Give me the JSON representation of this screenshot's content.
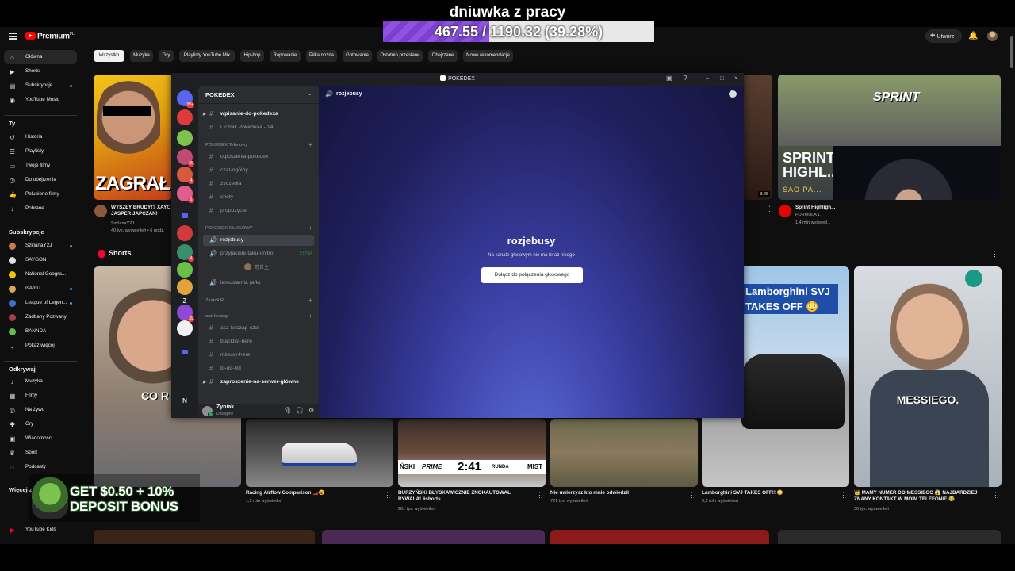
{
  "overlay": {
    "title": "dniuwka z pracy",
    "progress_text": "467.55 / 1190.32 (39.28%)",
    "progress_fraction": 0.3928,
    "progress_color": "#7c3fd1"
  },
  "youtube": {
    "brand": "Premium",
    "brand_sup": "PL",
    "create_label": "Utwórz",
    "nav": [
      {
        "label": "Główna",
        "icon": "home-icon",
        "active": true
      },
      {
        "label": "Shorts",
        "icon": "shorts-icon"
      },
      {
        "label": "Subskrypcje",
        "icon": "subscriptions-icon",
        "dot": true
      },
      {
        "label": "YouTube Music",
        "icon": "music-icon"
      }
    ],
    "you_heading": "Ty",
    "you_items": [
      {
        "label": "Historia",
        "icon": "history-icon"
      },
      {
        "label": "Playlisty",
        "icon": "playlist-icon"
      },
      {
        "label": "Twoje filmy",
        "icon": "video-icon"
      },
      {
        "label": "Do obejrzenia",
        "icon": "clock-icon"
      },
      {
        "label": "Polubione filmy",
        "icon": "like-icon"
      },
      {
        "label": "Pobrane",
        "icon": "download-icon"
      }
    ],
    "subs_heading": "Subskrypcje",
    "subs": [
      {
        "label": "SzklanaY2J",
        "color": "#c77b4a",
        "dot": true
      },
      {
        "label": "SAYGON",
        "color": "#e0e0e0"
      },
      {
        "label": "National Geogra...",
        "color": "#f5c400"
      },
      {
        "label": "IsAmU",
        "color": "#d9a85c",
        "dot": true
      },
      {
        "label": "League of Legen...",
        "color": "#3b6fd1",
        "dot": true
      },
      {
        "label": "Zadbany Pozwany",
        "color": "#a04040"
      },
      {
        "label": "BANNDA",
        "color": "#5cc24c"
      },
      {
        "label": "Pokaż więcej",
        "color": "",
        "icon": "chevron-down-icon"
      }
    ],
    "explore_heading": "Odkrywaj",
    "explore": [
      {
        "label": "Muzyka",
        "icon": "music-note-icon"
      },
      {
        "label": "Filmy",
        "icon": "film-icon"
      },
      {
        "label": "Na żywo",
        "icon": "live-icon"
      },
      {
        "label": "Gry",
        "icon": "gamepad-icon"
      },
      {
        "label": "Wiadomości",
        "icon": "news-icon"
      },
      {
        "label": "Sport",
        "icon": "trophy-icon"
      },
      {
        "label": "Podcasty",
        "icon": "podcast-icon"
      }
    ],
    "more_heading": "Więcej z",
    "more_items": [
      {
        "label": "YouTube Kids",
        "icon": "yt-kids-icon"
      }
    ],
    "chips": [
      "Wszystko",
      "Muzyka",
      "Gry",
      "Playlisty YouTube Mix",
      "Hip-hop",
      "Rapowanie",
      "Piłka nożna",
      "Gotowanie",
      "Ostatnio przesłane",
      "Obejrzane",
      "Nowe rekomendacje"
    ],
    "videos": [
      {
        "title": "WYSZŁY BRUDY!? XAYO JASPER JAPCZAN! SZK...",
        "channel": "SzklanaY2J",
        "meta": "40 tys. wyświetleń • 6 godz.",
        "thumb_text": "ZAGRAŁ"
      },
      {
        "title": "",
        "duration": "3:26"
      },
      {
        "title": "Sprint Highligh...",
        "channel": "FORMULA 1",
        "meta": "1,4 mln wyświetl...",
        "thumb_text": "SPRINT",
        "thumb_text2": "SPRINT HIGHL...",
        "thumb_text3": "SAO PA..."
      }
    ],
    "shorts_heading": "Shorts",
    "shorts": [
      {
        "title": "",
        "meta": "",
        "thumb_text": "CO R"
      },
      {
        "title": "Racing Airflow Comparison 🏎️😮",
        "meta": "1,2 mln wyświetleń"
      },
      {
        "title": "BURZYŃSKI BŁYSKAWICZNIE ZNOKAUTOWAŁ RYWALA! #shorts",
        "meta": "281 tys. wyświetleń",
        "thumb_text": "2:41",
        "thumb_text2": "PRIME",
        "thumb_text3": "RUNDA"
      },
      {
        "title": "Nie uwierzysz kto mnie odwiedził",
        "meta": "721 tys. wyświetleń"
      },
      {
        "title": "Lamborghini SVJ TAKES OFF!! 😳",
        "meta": "9,2 mln wyświetleń",
        "thumb_text": "Lamborghini SVJ TAKES OFF 😳"
      },
      {
        "title": "👑 MAMY NUMER DO MESSIEGO 😱 NAJBARDZIEJ ZNANY KONTAKT W MOIM TELEFONIE 😂",
        "meta": "36 tys. wyświetleń",
        "thumb_text": "MESSIEGO."
      }
    ]
  },
  "discord": {
    "window_title": "POKEDEX",
    "server_name": "POKEDEX",
    "channels_top": [
      {
        "name": "wpisanie-do-pokedexa",
        "bold": true,
        "caret": true
      },
      {
        "name": "Licznik Pokedexa - 14"
      }
    ],
    "cat1": "POKEDEX Tekstowy",
    "text_channels": [
      "ogloszenia-pokedex",
      "czat-ogólny",
      "życzenia",
      "shoty",
      "propozycje"
    ],
    "cat2": "POKEDEX GŁOSOWY",
    "voice_channels": [
      {
        "name": "rozjebusy",
        "selected": true
      },
      {
        "name": "przyjaciele-taku-i-nitro",
        "extra": "3:57:54"
      }
    ],
    "voice_user": "荒世主",
    "voice_afk": "lamusiarnia (afk)",
    "cat3": "Zespół R",
    "cat4": "asz-keczap",
    "cat4_channels": [
      "asz-keczap-czat",
      "blacklist-here",
      "minusy-here",
      "to-do-list"
    ],
    "channel_bottom": "zaproszenie-na-serwer-główne",
    "guild_letters": [
      "Z",
      "N"
    ],
    "guild_badges": [
      "99+",
      "39",
      "4",
      "6",
      "4",
      "39"
    ],
    "user_name": "Zyniak",
    "user_status": "Dostępny",
    "voice_title": "rozjebusy",
    "voice_sub": "Na kanale głosowym nie ma teraz nikogo",
    "join_label": "Dołącz do połączenia głosowego",
    "accent": "#5865f2"
  },
  "ad": {
    "line1": "GET $0.50 + 10%",
    "line2": "DEPOSIT BONUS"
  }
}
